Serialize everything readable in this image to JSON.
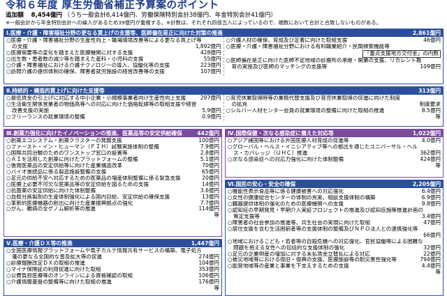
{
  "title": "令和６年度 厚生労働省補正予算案のポイント",
  "total": {
    "label": "追加額",
    "amount": "8,454億円",
    "breakdown": "（うち一般会計8,414億円、労働保険特別会計38億円、年金特別会計41億円）"
  },
  "note": "※一般会計から年金特別会計への繰入があるため39億円が重複する。※計数は、それぞれ四捨五入によっているので、端数において合計と合致しないものがある。",
  "sections": {
    "s1": {
      "title": "Ⅰ.医療・介護・障害福祉分野の更なる賃上げの支援等、医師偏在是正に向けた対策の推進",
      "amount": "2,861億円",
      "left": [
        {
          "t": "○医療・介護・障害福祉分野の生産性向上・職場環境改善等による更なる賃上げ等",
          "a": ""
        },
        {
          "t": "の支援",
          "a": "1,892億円",
          "cont": true
        },
        {
          "t": "○医療需要等の変化を踏まえた医療機関に対する支援",
          "a": "428億円"
        },
        {
          "t": "○出生数・患者数の減少等を踏まえた産科・小児科の支援",
          "a": "55億円"
        },
        {
          "t": "○介護・障害福祉における介護テクノロジーの導入、協働化等の支援",
          "a": "223億円"
        },
        {
          "t": "○訪問介護の提供体制の確保、障害者就労施設の経営改善等の支援",
          "a": "107億円"
        }
      ],
      "right": [
        {
          "t": "○介護人材の確保、育成及び定着に向けた取組支援",
          "a": "46億円"
        },
        {
          "t": "○医療・介護・障害福祉分野における有料職業紹介・民間検索機能等",
          "a": ""
        },
        {
          "t": "「重点支援地方交付金」の内数",
          "a": "",
          "box": true
        },
        {
          "t": "○医師偏在是正に向けた医師不足地域の診療所の承継・開業の支援、リカレント教",
          "a": ""
        },
        {
          "t": "育の実施及び医師のマッチングの支援等",
          "a": "109億円",
          "cont": true
        }
      ]
    },
    "s2": {
      "title": "Ⅱ.持続的・構造的賃上げに向けた支援等",
      "amount": "313億円",
      "left": [
        {
          "t": "○最低賃金の引上げに対応する中小企業・小規模事業者向け生産性向上支援",
          "a": "297億円"
        },
        {
          "t": "○生活衛生関係営業者の物価高等への対応に向けた価格転嫁等の取組支援や経営",
          "a": ""
        },
        {
          "t": "改善支援の実施",
          "a": "5.9億円",
          "cont": true
        },
        {
          "t": "○フリーランスの就業環境の整備",
          "a": "0.9億円"
        }
      ],
      "right": [
        {
          "t": "○育児休業取得時等の業務代替支援及び育児休業取得の促進に向けた制度",
          "a": ""
        },
        {
          "t": "の拡充",
          "a": "制度要求",
          "cont": true
        },
        {
          "t": "○シルバー人材センター会員の就業環境の整備に向けた取組の推進",
          "a": "8.5億円"
        },
        {
          "t": "",
          "a": "等",
          "right": true
        }
      ]
    },
    "s3": {
      "title": "Ⅲ.創薬力強化に向けたイノベーションの推進、医薬品等の安定供給確保",
      "amount": "442億円",
      "items": [
        {
          "t": "○創薬エコシステム・創薬クラスターの発展支援",
          "a": "100億円"
        },
        {
          "t": "○ファースト・イン・ヒューマン（ＦＩＨ）試験実施体制の整備",
          "a": "7.9億円"
        },
        {
          "t": "○国際共同治験のためのワンストップ窓口の設置等",
          "a": "2.8億円"
        },
        {
          "t": "○ＡＩを活用した創薬に向けたプラットフォームの整備",
          "a": "5.1億円"
        },
        {
          "t": "○後発医薬品の安定供給等に向けた産業構造改革",
          "a": "70億円"
        },
        {
          "t": "○バイオ後続品に係る製造施設整備の支援",
          "a": "65億円"
        },
        {
          "t": "○足元の供給不安へ対応するための医薬品の増産体制整備に係る緊急支援",
          "a": "20億円"
        },
        {
          "t": "○医療上必要不可欠な医薬品等の安定供給を図るための支援",
          "a": "14億円"
        },
        {
          "t": "○抗菌薬の安定供給に向けた体制整備",
          "a": "3.6億円"
        },
        {
          "t": "○血漿分画製剤の生産体制強化による国内自給、安定供給の確保支援",
          "a": "13億円"
        },
        {
          "t": "○革新的医療機器の創出に向けた産業振興拠点の強化",
          "a": "7.7億円"
        },
        {
          "t": "○がん、難病の全ゲノム解析等の推進",
          "a": "114億円"
        },
        {
          "t": "",
          "a": "等",
          "right": true
        }
      ]
    },
    "s4": {
      "title": "Ⅳ.国際保健・次なる感染症に備えた対応等",
      "amount": "1,022億円",
      "items": [
        {
          "t": "○アジア諸国等における外国医療人材育成の促進等",
          "a": "4.0億円"
        },
        {
          "t": "○グローバル・ヘルス・イニシアティブ等への拠出を通じたユニバーサル・ヘル",
          "a": ""
        },
        {
          "t": "ス・カバレッジ（ＵＨＣ）推進",
          "a": "362億円",
          "cont": true
        },
        {
          "t": "○次なる感染症への対応力強化に向けた体制整備",
          "a": "424億円"
        },
        {
          "t": "",
          "a": "等",
          "right": true
        }
      ]
    },
    "s5": {
      "title": "Ⅴ.医療・介護ＤＸ等の推進",
      "amount": "1,447億円",
      "items": [
        {
          "t": "○全国医療情報プラットフォームや電子カルテ情報共有サービスの構築、電子処方",
          "a": ""
        },
        {
          "t": "箋の更なる全国的な普及拡大等の促進",
          "a": "274億円",
          "cont": true
        },
        {
          "t": "○診療報酬改定ＤＸの取組の推進",
          "a": "104億円"
        },
        {
          "t": "○マイナ保険証の利用促進に向けた取組",
          "a": "353億円"
        },
        {
          "t": "○公費負担医療等のオンラインによる資格確認の取組",
          "a": "106億円"
        },
        {
          "t": "○介護情報基盤の整備等に向けた取組の推進",
          "a": "176億円"
        },
        {
          "t": "",
          "a": "等",
          "right": true
        }
      ]
    },
    "s6": {
      "title": "Ⅵ.国民の安心・安全の確保",
      "amount": "2,205億円",
      "items": [
        {
          "t": "○機能性表示食品等に係る健康被害への対応強化",
          "a": "6.4億円"
        },
        {
          "t": "○女性の健康総合センターの体制の充実、相談支援体制の構築",
          "a": "6.9億円"
        },
        {
          "t": "○臓器提供体制の強化のための医療機関への支援",
          "a": "9.8億円"
        },
        {
          "t": "○認知症の早期発見・早期介入実証プロジェクトの推進及び認知症施策推進計画の",
          "a": ""
        },
        {
          "t": "策定支援等",
          "a": "3.4億円",
          "cont": true
        },
        {
          "t": "○障害者の社会参加の推進等、共生社会の実現に向けた取組",
          "a": "47億円"
        },
        {
          "t": "○居住支援を含む生活困窮者等の支援体制の整備及びＮＰＯ法人との連携強化等",
          "a": ""
        },
        {
          "t": "",
          "a": "66億円",
          "right": true
        },
        {
          "t": "○地域におけるこども・若者等の自殺危機への対応強化、官民協働等による困難な",
          "a": ""
        },
        {
          "t": "問題を抱える女性への包括的な支援体制の強化",
          "a": "32億円",
          "cont": true
        },
        {
          "t": "○足元の企業倒産の増加に対する未払賃金立替払による対応",
          "a": "22億円"
        },
        {
          "t": "○被災地域等における復旧・復興の支援、医療施設等の耐災害性強化等",
          "a": "794億円"
        },
        {
          "t": "○能登地域等の産業と事業を下支えするための支援",
          "a": "4.4億円"
        },
        {
          "t": "",
          "a": "等",
          "right": true
        }
      ]
    }
  }
}
